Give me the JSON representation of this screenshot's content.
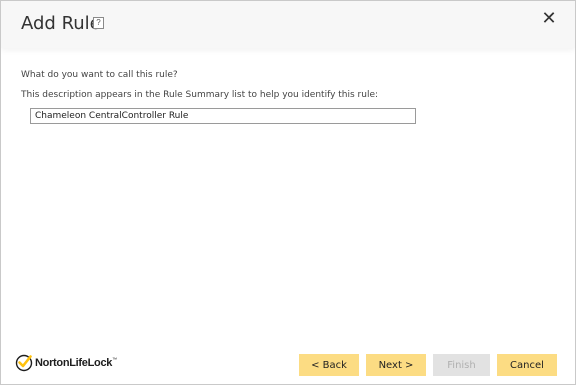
{
  "dialog": {
    "title": "Add Rule",
    "help_icon": "help-icon",
    "help_glyph": "?",
    "close_icon": "close-icon",
    "close_glyph": "✕"
  },
  "form": {
    "question": "What do you want to call this rule?",
    "description": "This description appears in the Rule Summary list to help you identify this rule:",
    "rule_name_value": "Chameleon CentralController Rule"
  },
  "brand": {
    "name": "NortonLifeLock",
    "trademark": "™",
    "check_color": "#ffc20e"
  },
  "buttons": {
    "back_label": "< Back",
    "next_label": "Next >",
    "finish_label": "Finish",
    "cancel_label": "Cancel"
  },
  "colors": {
    "button_accent": "#fcdc83",
    "button_disabled": "#e2e2e2"
  }
}
